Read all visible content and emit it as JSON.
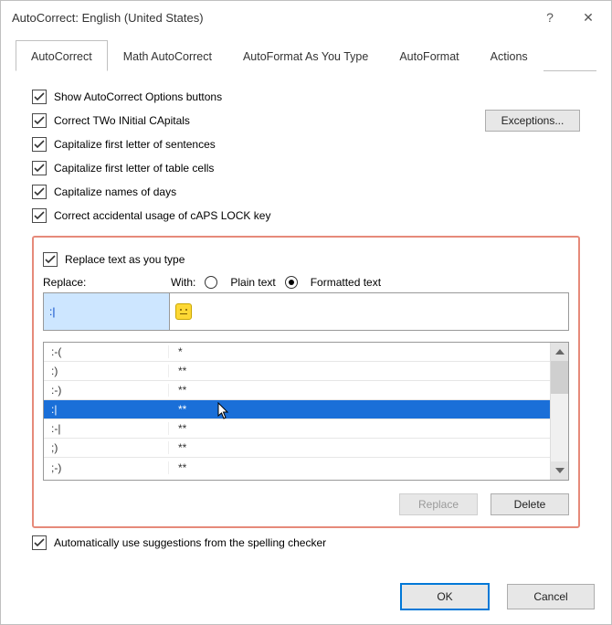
{
  "window": {
    "title": "AutoCorrect: English (United States)",
    "help": "?",
    "close": "✕"
  },
  "tabs": [
    {
      "label": "AutoCorrect",
      "active": true
    },
    {
      "label": "Math AutoCorrect",
      "active": false
    },
    {
      "label": "AutoFormat As You Type",
      "active": false
    },
    {
      "label": "AutoFormat",
      "active": false
    },
    {
      "label": "Actions",
      "active": false
    }
  ],
  "topChecks": {
    "c0": "Show AutoCorrect Options buttons",
    "c1": "Correct TWo INitial CApitals",
    "c2": "Capitalize first letter of sentences",
    "c3": "Capitalize first letter of table cells",
    "c4": "Capitalize names of days",
    "c5": "Correct accidental usage of cAPS LOCK key"
  },
  "exceptionsBtn": "Exceptions...",
  "replaceSection": {
    "replaceTextAsYouType": "Replace text as you type",
    "replaceLabel": "Replace:",
    "withLabel": "With:",
    "plainText": "Plain text",
    "formattedText": "Formatted text",
    "replaceValue": ":|",
    "withValue": "😐"
  },
  "listRows": [
    {
      "c1": ":-(",
      "c2": "*",
      "sel": false
    },
    {
      "c1": ":)",
      "c2": "**",
      "sel": false
    },
    {
      "c1": ":-)",
      "c2": "**",
      "sel": false
    },
    {
      "c1": ":|",
      "c2": "**",
      "sel": true
    },
    {
      "c1": ":-|",
      "c2": "**",
      "sel": false
    },
    {
      "c1": ";)",
      "c2": "**",
      "sel": false
    },
    {
      "c1": ";-)",
      "c2": "**",
      "sel": false
    }
  ],
  "replaceBtn": "Replace",
  "deleteBtn": "Delete",
  "autoSuggest": "Automatically use suggestions from the spelling checker",
  "ok": "OK",
  "cancel": "Cancel"
}
